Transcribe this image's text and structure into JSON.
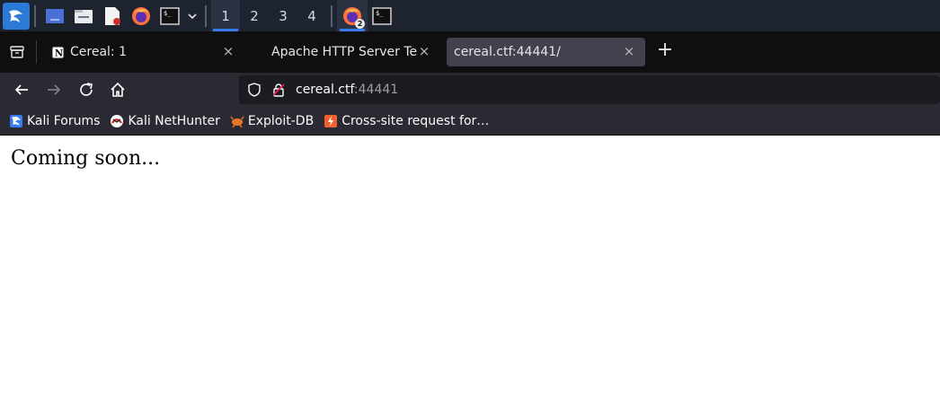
{
  "taskbar": {
    "workspaces": [
      "1",
      "2",
      "3",
      "4"
    ],
    "active_workspace": "1",
    "firefox_badge": "2",
    "icons": [
      "kali-menu-icon",
      "desktop-icon",
      "file-manager-icon",
      "text-editor-icon",
      "firefox-icon",
      "terminal-icon",
      "chevron-down-icon",
      "firefox-window-icon",
      "terminal-window-icon"
    ]
  },
  "tabs": [
    {
      "title": "Cereal: 1",
      "active": false
    },
    {
      "title": "Apache HTTP Server Test",
      "active": false
    },
    {
      "title": "cereal.ctf:44441/",
      "active": true
    }
  ],
  "tab_close_glyph": "×",
  "new_tab_glyph": "+",
  "urlbar": {
    "host": "cereal.ctf",
    "port": ":44441"
  },
  "bookmarks": [
    {
      "label": "Kali Forums",
      "icon": "kali-forums-icon"
    },
    {
      "label": "Kali NetHunter",
      "icon": "kali-nethunter-icon"
    },
    {
      "label": "Exploit-DB",
      "icon": "exploit-db-icon"
    },
    {
      "label": "Cross-site request for…",
      "icon": "csrf-icon"
    }
  ],
  "page": {
    "text": "Coming soon..."
  },
  "colors": {
    "taskbar_bg": "#1e2330",
    "accent": "#367bf0",
    "tabbar_bg": "#0f0f12",
    "toolbar_bg": "#2b2a33",
    "urlbar_bg": "#1c1b22"
  }
}
